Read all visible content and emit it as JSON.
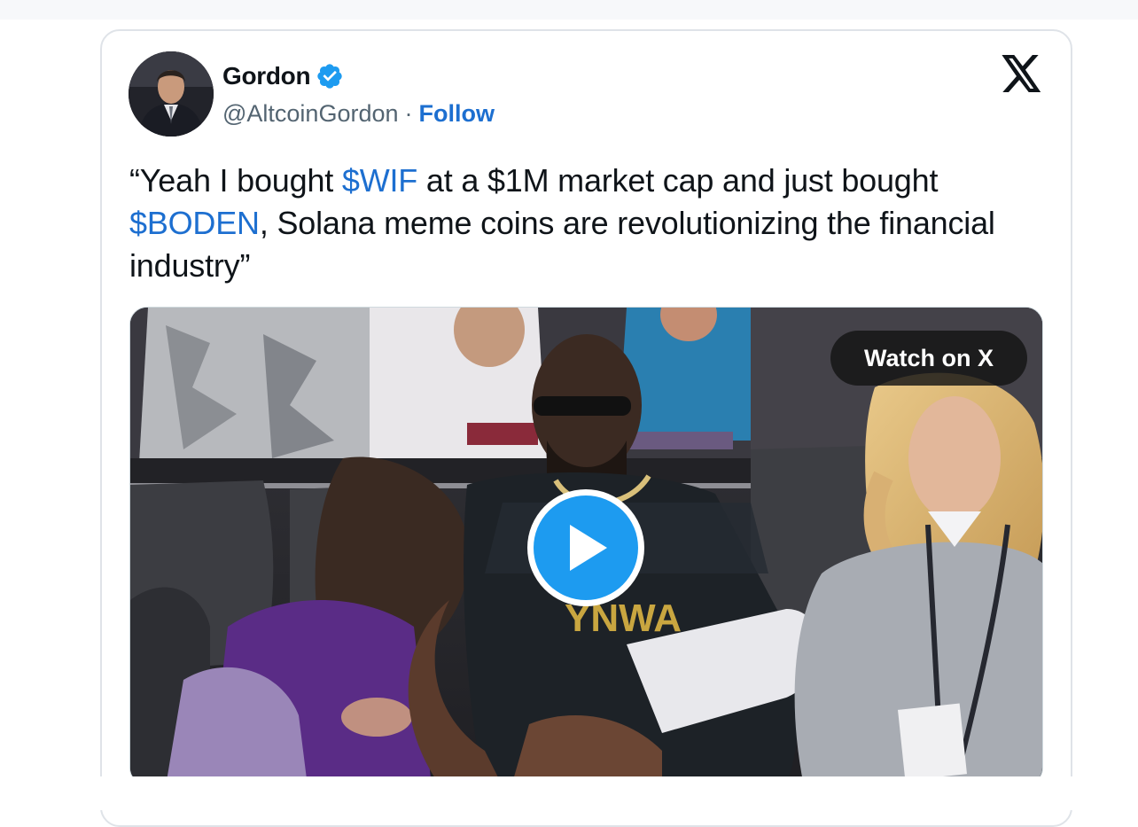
{
  "author": {
    "name": "Gordon",
    "handle": "@AltcoinGordon",
    "separator": "·",
    "follow_label": "Follow",
    "verified_icon": "verified-badge-icon",
    "verified_color": "#1d9bf0"
  },
  "tweet": {
    "part1": "“Yeah I bought ",
    "cashtag1": "$WIF",
    "part2": " at a $1M market cap and just bought ",
    "cashtag2": "$BODEN",
    "part3": ", Solana meme coins are revolutionizing the financial industry”"
  },
  "media": {
    "watch_label": "Watch on X",
    "play_icon": "play-icon",
    "jersey_text": "YNWA"
  },
  "colors": {
    "link": "#1d6fd0",
    "text": "#0f1419",
    "muted": "#536471",
    "play": "#1d9bf0"
  }
}
